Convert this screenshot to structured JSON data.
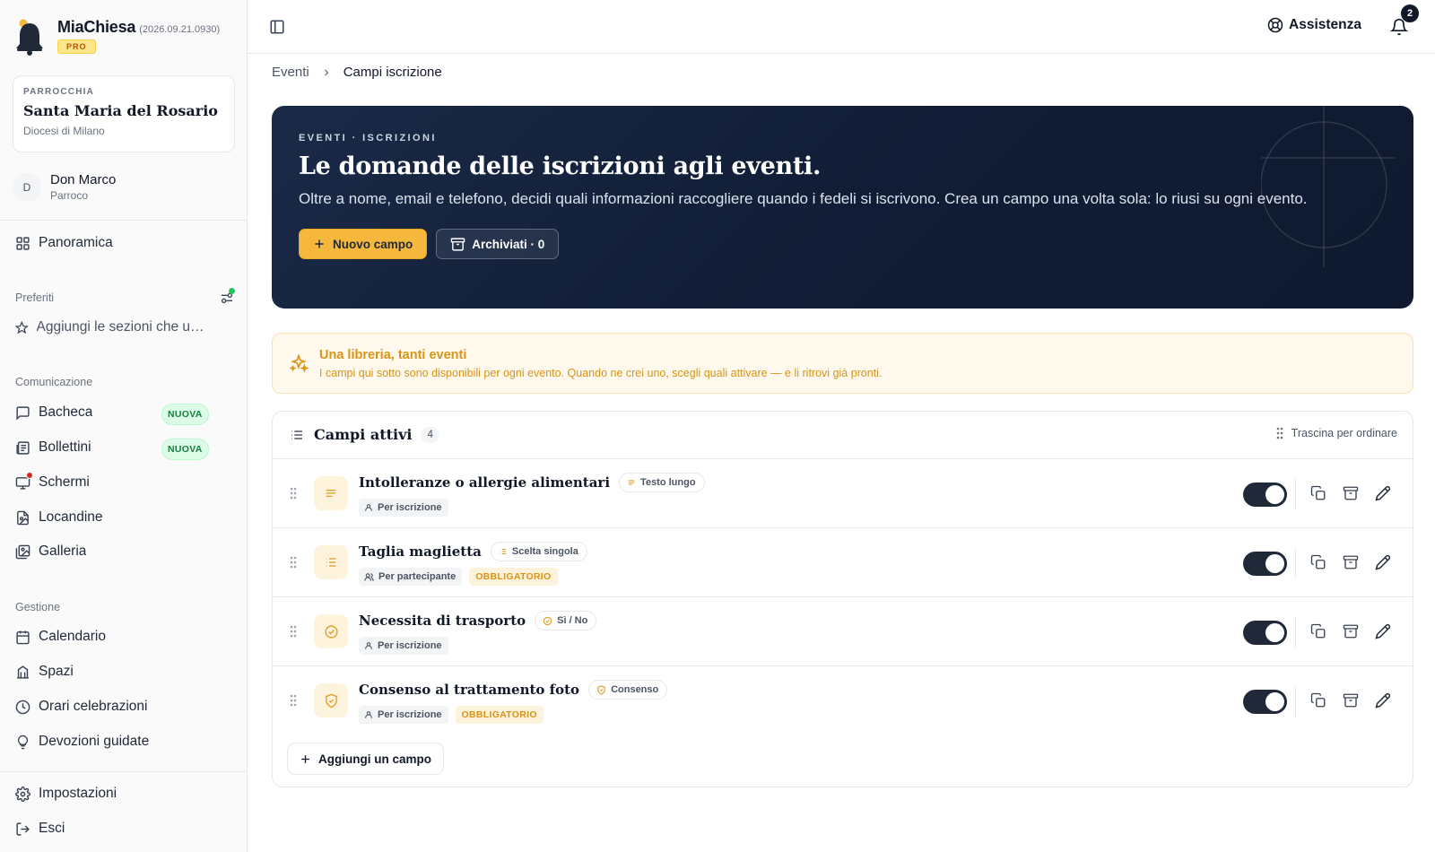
{
  "brand": {
    "name": "MiaChiesa",
    "version": "(2026.09.21.0930)",
    "plan": "PRO"
  },
  "parish": {
    "label": "PARROCCHIA",
    "name": "Santa Maria del Rosario",
    "diocese": "Diocesi di Milano"
  },
  "user": {
    "initial": "D",
    "name": "Don Marco",
    "role": "Parroco"
  },
  "nav": {
    "overview": "Panoramica",
    "favorites_title": "Preferiti",
    "favorites_hint": "Aggiungi le sezioni che usi di più",
    "communication_title": "Comunicazione",
    "communication": [
      {
        "label": "Bacheca",
        "badge": "NUOVA"
      },
      {
        "label": "Bollettini",
        "badge": "NUOVA"
      },
      {
        "label": "Schermi"
      },
      {
        "label": "Locandine"
      },
      {
        "label": "Galleria"
      }
    ],
    "management_title": "Gestione",
    "management": [
      {
        "label": "Calendario"
      },
      {
        "label": "Spazi"
      },
      {
        "label": "Orari celebrazioni"
      },
      {
        "label": "Devozioni guidate"
      }
    ],
    "settings": "Impostazioni",
    "logout": "Esci"
  },
  "topbar": {
    "help": "Assistenza",
    "notifications_count": "2"
  },
  "breadcrumb": {
    "parent": "Eventi",
    "current": "Campi iscrizione"
  },
  "hero": {
    "kicker": "EVENTI · ISCRIZIONI",
    "title": "Le domande delle iscrizioni agli eventi.",
    "description": "Oltre a nome, email e telefono, decidi quali informazioni raccogliere quando i fedeli si iscrivono. Crea un campo una volta sola: lo riusi su ogni evento.",
    "new_button": "Nuovo campo",
    "archived_button": "Archiviati · 0"
  },
  "info": {
    "title": "Una libreria, tanti eventi",
    "text": "I campi qui sotto sono disponibili per ogni evento. Quando ne crei uno, scegli quali attivare — e li ritrovi già pronti."
  },
  "fields_card": {
    "title": "Campi attivi",
    "count": "4",
    "drag_hint": "Trascina per ordinare",
    "add_button": "Aggiungi un campo",
    "rows": [
      {
        "name": "Intolleranze o allergie alimentari",
        "type": "Testo lungo",
        "type_icon": "text-lines-icon",
        "scope": "Per iscrizione",
        "scope_icon": "user-icon",
        "required": "",
        "enabled": true
      },
      {
        "name": "Taglia maglietta",
        "type": "Scelta singola",
        "type_icon": "list-icon",
        "scope": "Per partecipante",
        "scope_icon": "users-icon",
        "required": "OBBLIGATORIO",
        "enabled": true
      },
      {
        "name": "Necessita di trasporto",
        "type": "Sì / No",
        "type_icon": "check-circle-icon",
        "scope": "Per iscrizione",
        "scope_icon": "user-icon",
        "required": "",
        "enabled": true
      },
      {
        "name": "Consenso al trattamento foto",
        "type": "Consenso",
        "type_icon": "shield-check-icon",
        "scope": "Per iscrizione",
        "scope_icon": "user-icon",
        "required": "OBBLIGATORIO",
        "enabled": true
      }
    ]
  },
  "colors": {
    "accent": "#f5b83d",
    "hero_bg": "#111d36",
    "success": "#15803d",
    "toggle_on": "#1f2937"
  }
}
